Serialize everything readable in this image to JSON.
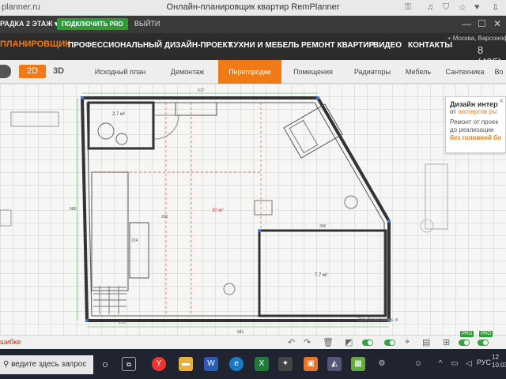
{
  "browser": {
    "url_fragment": "planner.ru",
    "page_title": "Онлайн-планировщик квартир RemPlanner"
  },
  "topbar": {
    "floor_selector": "РАДКА 2 ЭТАЖ",
    "pro_button": "ПОДКЛЮЧИТЬ PRO",
    "logout": "ВЫЙТИ"
  },
  "nav": {
    "planner": "ПЛАНИРОВЩИК",
    "items": [
      {
        "label": "ПРОФЕССИОНАЛЬНЫЙ ДИЗАЙН-ПРОЕКТ"
      },
      {
        "label": "КУХНИ И МЕБЕЛЬ"
      },
      {
        "label": "РЕМОНТ КВАРТИР"
      },
      {
        "label": "ВИДЕО"
      },
      {
        "label": "КОНТАКТЫ"
      }
    ],
    "location": "Москва, Варсоноф",
    "phone": "8 (495)"
  },
  "modes": {
    "d2": "2D",
    "d3": "3D"
  },
  "tabs": [
    {
      "label": "Исходный план"
    },
    {
      "label": "Демонтаж"
    },
    {
      "label": "Перегородки",
      "active": true
    },
    {
      "label": "Помещения"
    },
    {
      "label": "Радиаторы"
    },
    {
      "label": "Мебель"
    },
    {
      "label": "Сантехника"
    },
    {
      "label": "Во"
    }
  ],
  "plan": {
    "dimension_top": "617",
    "dimension_left": "580",
    "dimension_bottom": "681",
    "room_main_area": "30 м²",
    "room_bath_area": "2.7 м²",
    "room_right_area": "7.7 м²",
    "dim_right_room": "396",
    "dim_small_a": "224",
    "dim_small_b": "175",
    "dim_inner": "206"
  },
  "promo": {
    "title": "Дизайн интер",
    "sub_prefix": "от",
    "sub_accent": "экспертов ры",
    "body_1": "Ремонт от проек",
    "body_2": "до реализации",
    "strong": "без головной бо"
  },
  "bottombar": {
    "error": "шибке",
    "published": "Опубликовать в"
  },
  "taskbar": {
    "search_placeholder": "ведите здесь запрос",
    "lang": "РУС",
    "clock_1": "12",
    "clock_2": "10.03"
  },
  "colors": {
    "accent": "#f07a16",
    "pro_green": "#2e9b3a",
    "nav_dark": "#2c2c2c"
  }
}
